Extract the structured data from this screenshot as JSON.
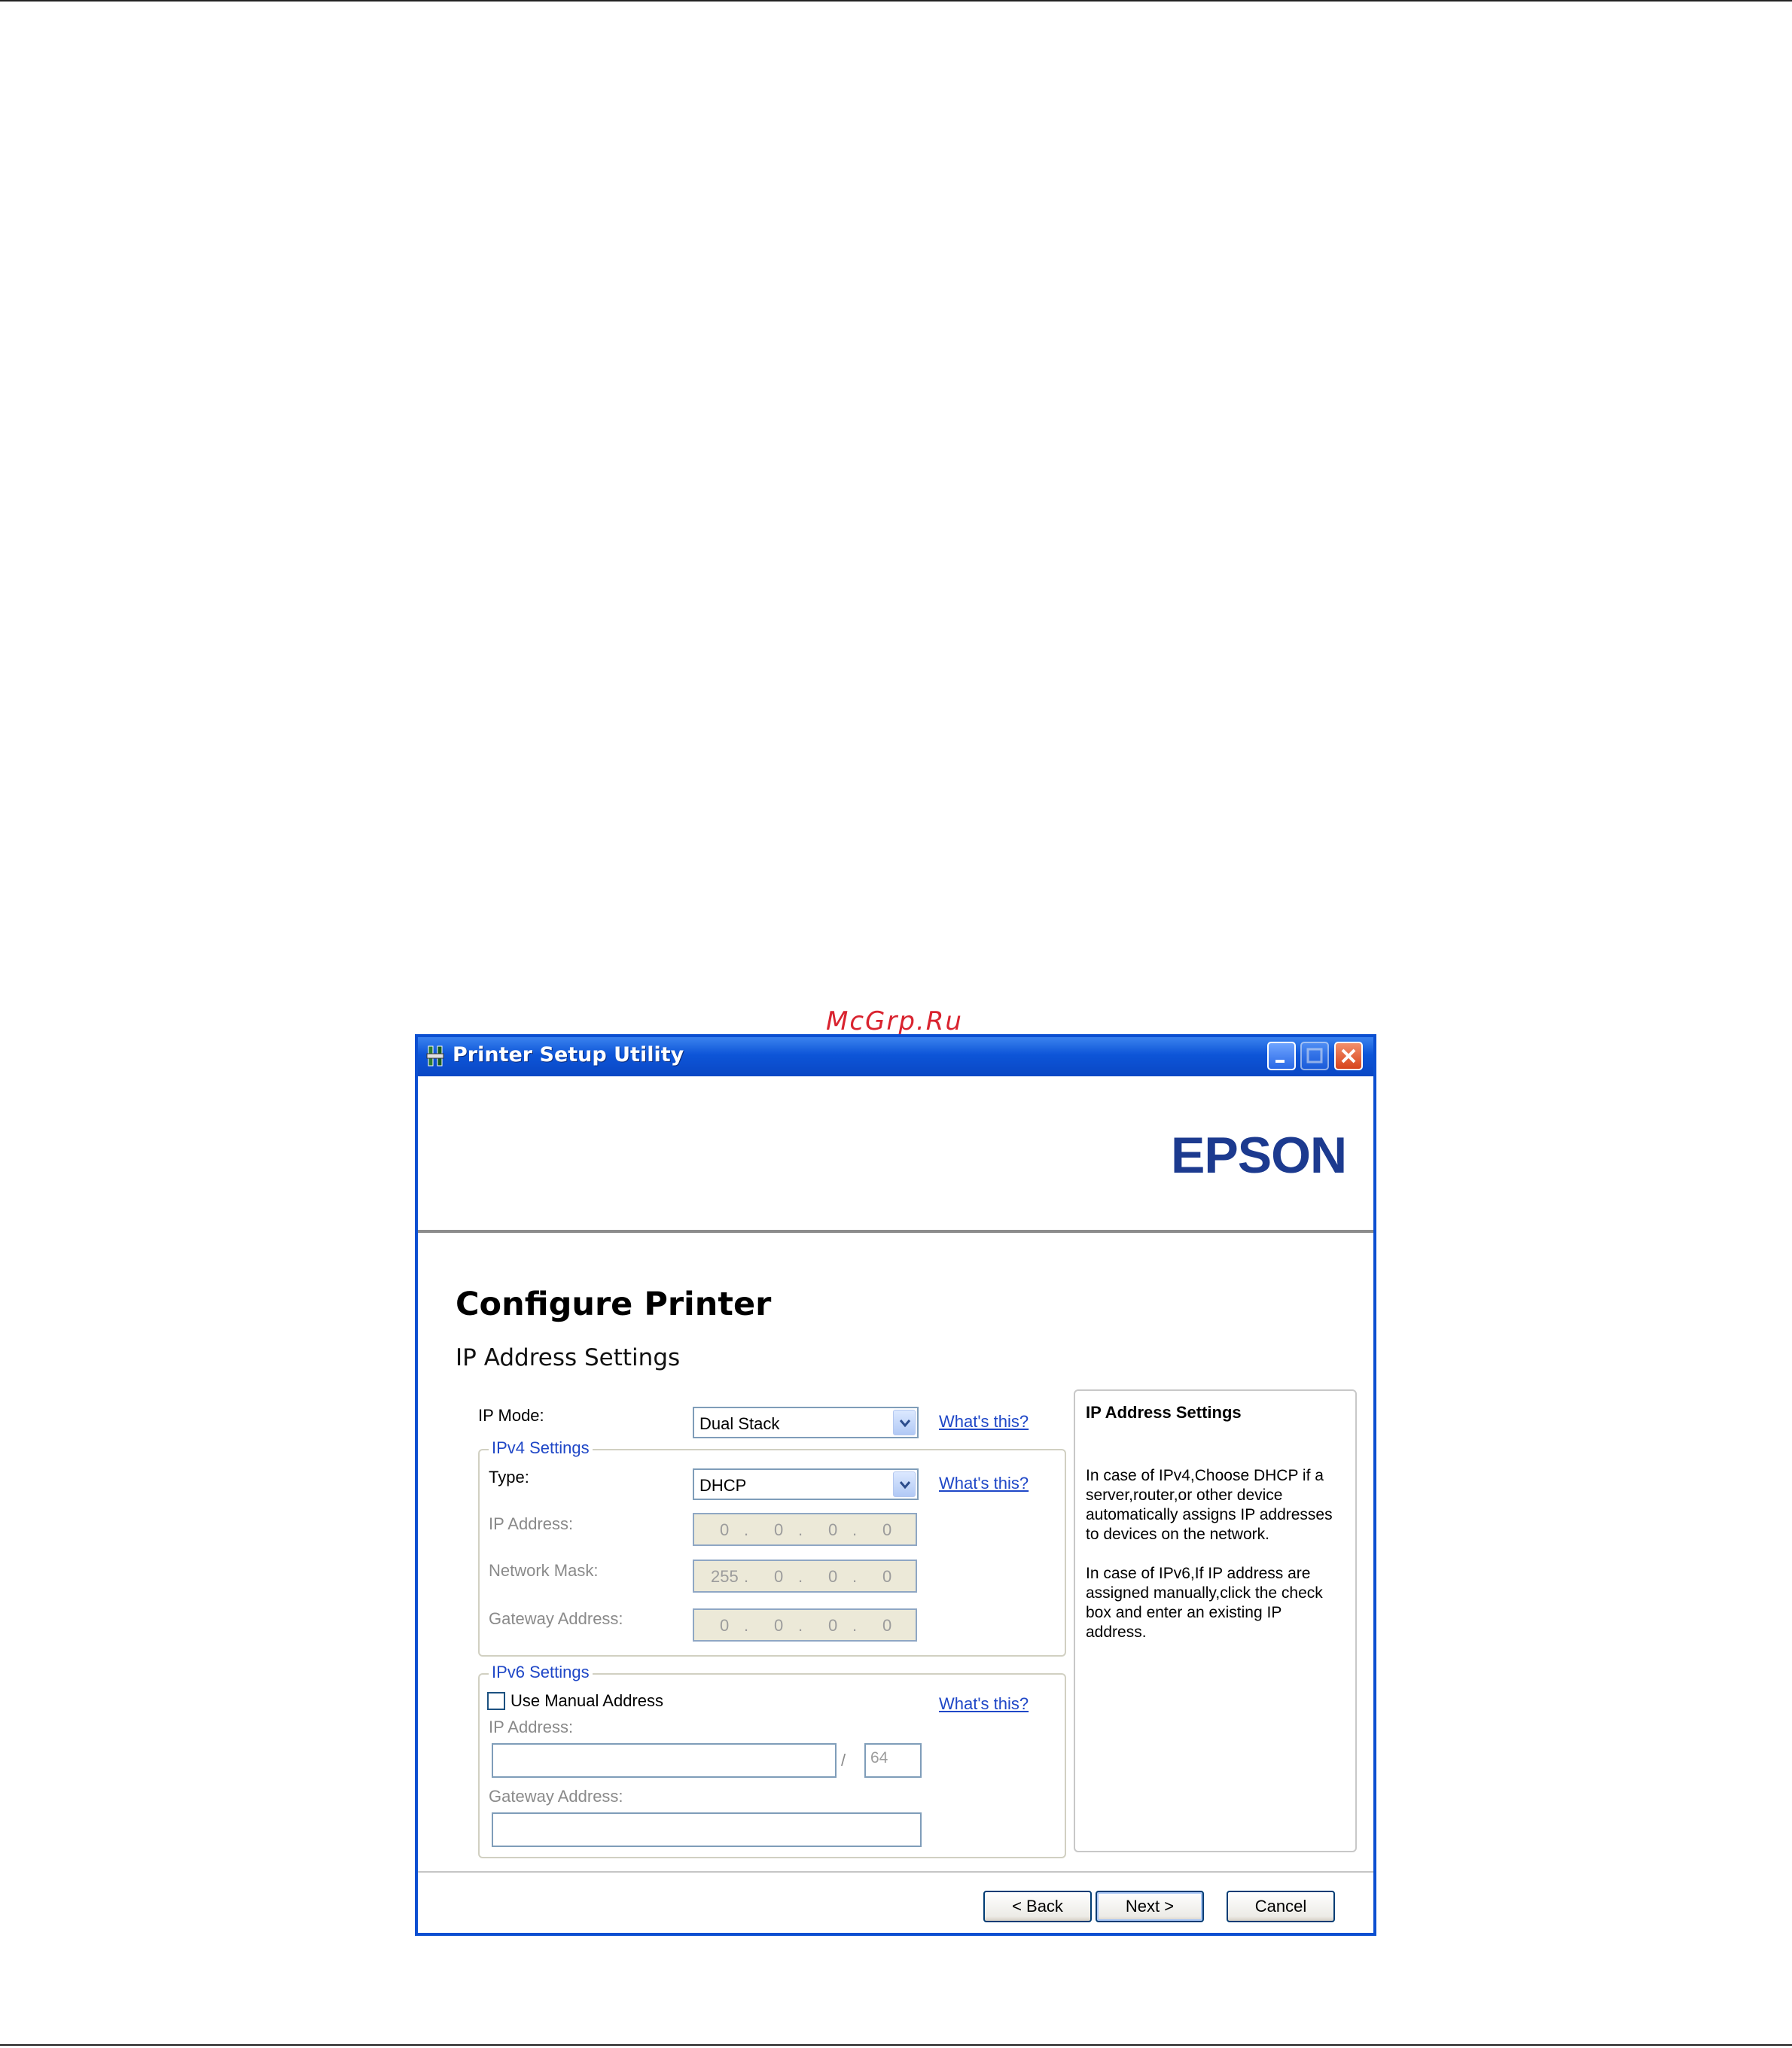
{
  "watermark": "McGrp.Ru",
  "window": {
    "title": "Printer Setup Utility",
    "controls": {
      "minimize": "minimize",
      "maximize": "maximize",
      "close": "close"
    }
  },
  "header": {
    "logo": "EPSON"
  },
  "page": {
    "title": "Configure Printer",
    "subtitle": "IP Address Settings"
  },
  "ip_mode": {
    "label": "IP Mode:",
    "value": "Dual Stack",
    "help_link": "What's this?"
  },
  "ipv4": {
    "legend": "IPv4 Settings",
    "type_label": "Type:",
    "type_value": "DHCP",
    "help_link": "What's this?",
    "ip_address": {
      "label": "IP Address:",
      "octets": [
        "0",
        "0",
        "0",
        "0"
      ]
    },
    "network_mask": {
      "label": "Network Mask:",
      "octets": [
        "255",
        "0",
        "0",
        "0"
      ]
    },
    "gateway": {
      "label": "Gateway Address:",
      "octets": [
        "0",
        "0",
        "0",
        "0"
      ]
    }
  },
  "ipv6": {
    "legend": "IPv6 Settings",
    "manual_label": "Use Manual Address",
    "manual_checked": false,
    "help_link": "What's this?",
    "ip_address_label": "IP Address:",
    "ip_address_value": "",
    "separator": "/",
    "prefix_value": "64",
    "gateway_label": "Gateway Address:",
    "gateway_value": ""
  },
  "help_panel": {
    "title": "IP Address Settings",
    "paragraph1": "In case of IPv4,Choose DHCP if a server,router,or other device automatically assigns IP addresses to devices on the network.",
    "paragraph2": "In case of IPv6,If IP address are assigned manually,click the check box and enter an existing IP address."
  },
  "buttons": {
    "back": "< Back",
    "next": "Next >",
    "cancel": "Cancel"
  }
}
